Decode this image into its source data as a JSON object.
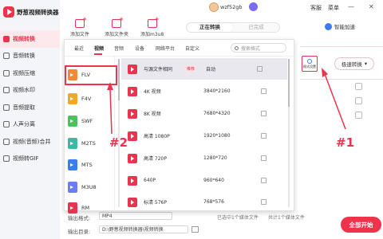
{
  "app": {
    "title": "野葱视频转换器"
  },
  "colors": {
    "accent": "#e8344e",
    "annotation": "#e8344e",
    "link_blue": "#3b7df0"
  },
  "header": {
    "username": "wzf52gb",
    "service_label": "客服",
    "menu_label": "菜单",
    "smart_accel_label": "智能加速"
  },
  "sidebar": {
    "items": [
      {
        "label": "视频转换",
        "icon": "video-convert-icon",
        "active": true
      },
      {
        "label": "音频转换",
        "icon": "audio-convert-icon"
      },
      {
        "label": "视频压缩",
        "icon": "video-compress-icon"
      },
      {
        "label": "视频水印",
        "icon": "video-watermark-icon"
      },
      {
        "label": "音频提取",
        "icon": "audio-extract-icon"
      },
      {
        "label": "人声分离",
        "icon": "vocal-separate-icon"
      },
      {
        "label": "视频(音频)合并",
        "icon": "merge-icon"
      },
      {
        "label": "视频转GIF",
        "icon": "gif-icon"
      }
    ]
  },
  "toolbar": {
    "add_file": "添加文件",
    "add_folder": "添加文件夹",
    "add_m3u8": "添加m3u8"
  },
  "main_tabs": {
    "converting": "正在转换",
    "converted": "已完成"
  },
  "main": {
    "advanced_settings": "格式设置",
    "mode_label": "极速转换"
  },
  "popup": {
    "tabs": [
      "最近",
      "视频",
      "音频",
      "设备",
      "网络平台",
      "自定义"
    ],
    "active_tab": "视频",
    "search_placeholder": "搜索格式",
    "formats": [
      {
        "name": "FLV",
        "color": "#f08a3a",
        "selected": true
      },
      {
        "name": "F4V",
        "color": "#f3a62a"
      },
      {
        "name": "SWF",
        "color": "#4fbf5c"
      },
      {
        "name": "M2TS",
        "color": "#3fb7a6"
      },
      {
        "name": "MTS",
        "color": "#3b7df0"
      },
      {
        "name": "M3U8",
        "color": "#6b7cf5"
      },
      {
        "name": "RM",
        "color": "#e8344e"
      }
    ],
    "resolutions": [
      {
        "name": "与源文件相同",
        "badge": "推荐",
        "value": "自动",
        "active": true
      },
      {
        "name": "4K 视频",
        "value": "3840*2160"
      },
      {
        "name": "8K 视频",
        "value": "7680*4320"
      },
      {
        "name": "高清 1080P",
        "value": "1920*1080"
      },
      {
        "name": "高清 720P",
        "value": "1280*720"
      },
      {
        "name": "640P",
        "value": "960*640"
      },
      {
        "name": "标清 576P",
        "value": "768*576"
      }
    ]
  },
  "bottom": {
    "output_format_label": "输出格式:",
    "output_format_value": "MP4",
    "output_dir_label": "输出目录:",
    "output_dir_value": "D:\\野葱视频转换器\\视频转换",
    "note_left": "已选中1个媒体文件",
    "note_right": "共计1个媒体文件",
    "convert_all": "全部开始"
  },
  "annotations": {
    "one": "#1",
    "two": "#2"
  }
}
